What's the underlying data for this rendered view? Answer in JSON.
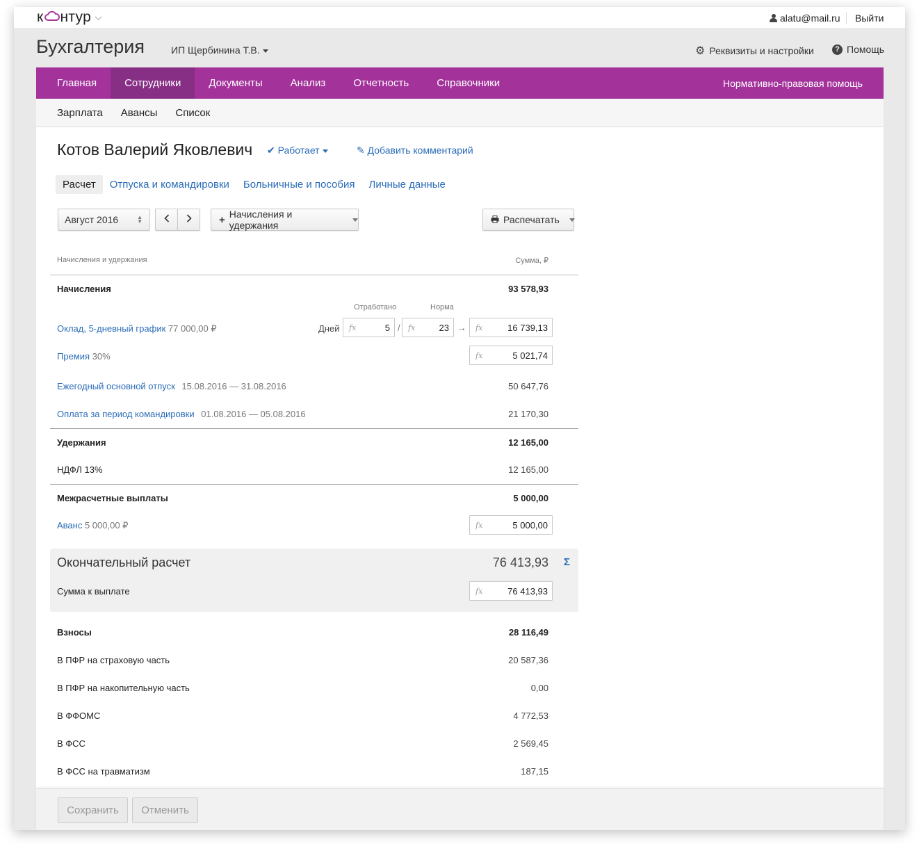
{
  "topbar": {
    "logo_text_a": "к",
    "logo_text_b": "нтур",
    "user_email": "alatu@mail.ru",
    "logout": "Выйти"
  },
  "header": {
    "app_title": "Бухгалтерия",
    "org_name": "ИП Щербинина Т.В.",
    "settings": "Реквизиты и настройки",
    "help": "Помощь"
  },
  "nav": {
    "items": [
      "Главная",
      "Сотрудники",
      "Документы",
      "Анализ",
      "Отчетность",
      "Справочники"
    ],
    "right": "Нормативно-правовая помощь",
    "active": "Сотрудники"
  },
  "subnav": {
    "items": [
      "Зарплата",
      "Авансы",
      "Список"
    ]
  },
  "employee": {
    "name": "Котов Валерий Яковлевич",
    "status": "Работает",
    "add_comment": "Добавить комментарий"
  },
  "tabs": [
    "Расчет",
    "Отпуска и командировки",
    "Больничные и пособия",
    "Личные данные"
  ],
  "toolbar": {
    "month": "Август 2016",
    "add_label": "Начисления и удержания",
    "print_label": "Распечатать"
  },
  "table": {
    "col_left": "Начисления и удержания",
    "col_right": "Сумма, ₽",
    "accruals": {
      "title": "Начисления",
      "total": "93 578,93",
      "worked_label": "Отработано",
      "norm_label": "Норма",
      "days_label": "Дней",
      "salary_link": "Оклад, 5-дневный график",
      "salary_note": "77 000,00 ₽",
      "worked_days": "5",
      "norm_days": "23",
      "salary_amount": "16 739,13",
      "bonus_link": "Премия",
      "bonus_note": "30%",
      "bonus_amount": "5 021,74",
      "vacation_link": "Ежегодный основной отпуск",
      "vacation_period": "15.08.2016 — 31.08.2016",
      "vacation_amount": "50 647,76",
      "trip_link": "Оплата за период командировки",
      "trip_period": "01.08.2016 — 05.08.2016",
      "trip_amount": "21 170,30"
    },
    "deductions": {
      "title": "Удержания",
      "total": "12 165,00",
      "ndfl_label": "НДФЛ 13%",
      "ndfl_amount": "12 165,00"
    },
    "interim": {
      "title": "Межрасчетные выплаты",
      "total": "5 000,00",
      "advance_link": "Аванс",
      "advance_note": "5 000,00 ₽",
      "advance_amount": "5 000,00"
    },
    "final": {
      "title": "Окончательный расчет",
      "amount": "76 413,93",
      "payout_label": "Сумма к выплате",
      "payout_amount": "76 413,93"
    },
    "contrib": {
      "title": "Взносы",
      "total": "28 116,49",
      "rows": [
        {
          "label": "В ПФР на страховую часть",
          "amount": "20 587,36"
        },
        {
          "label": "В ПФР на накопительную часть",
          "amount": "0,00"
        },
        {
          "label": "В ФФОМС",
          "amount": "4 772,53"
        },
        {
          "label": "В ФСС",
          "amount": "2 569,45"
        },
        {
          "label": "В ФСС на травматизм",
          "amount": "187,15"
        }
      ]
    }
  },
  "footer": {
    "save": "Сохранить",
    "cancel": "Отменить"
  },
  "colors": {
    "nav_bg": "#a3329b",
    "nav_active": "#872e85",
    "link": "#2a6cb8"
  }
}
